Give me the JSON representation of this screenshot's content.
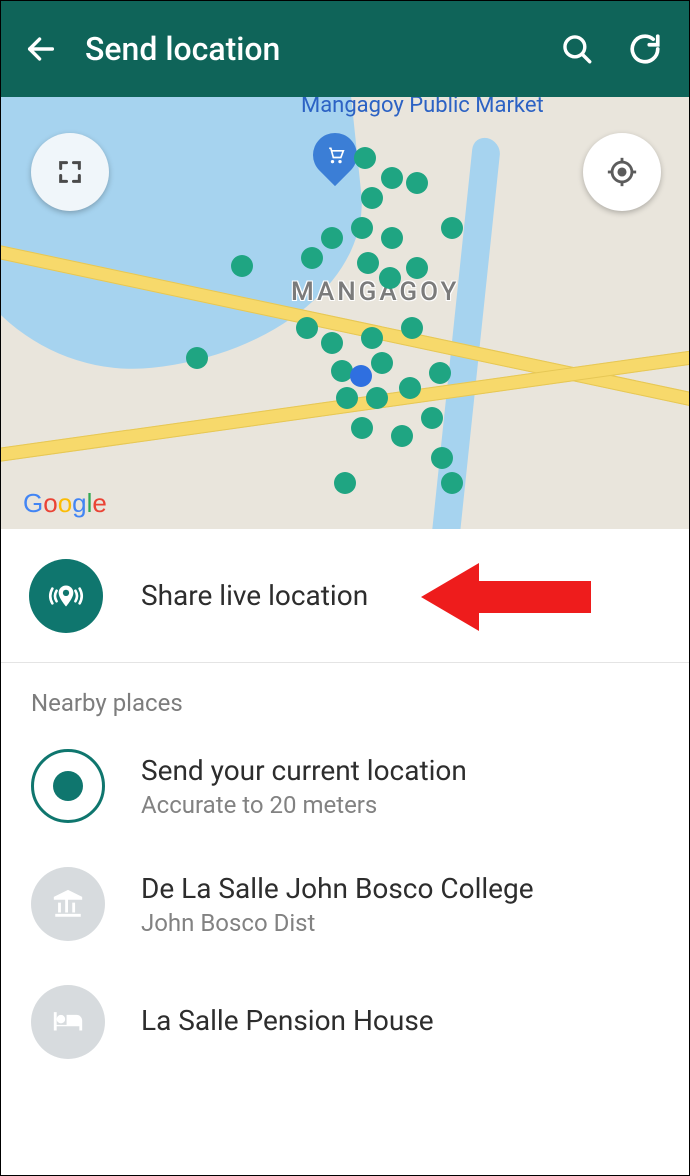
{
  "header": {
    "title": "Send location"
  },
  "map": {
    "city_label": "MANGAGOY",
    "market_label": "Mangagoy Public Market",
    "watermark": "Google"
  },
  "share": {
    "label": "Share live location"
  },
  "nearby": {
    "section": "Nearby places",
    "current": {
      "title": "Send your current location",
      "sub": "Accurate to 20 meters"
    },
    "places": [
      {
        "name": "De La Salle John Bosco College",
        "sub": "John Bosco Dist"
      },
      {
        "name": "La Salle Pension House",
        "sub": ""
      }
    ]
  }
}
